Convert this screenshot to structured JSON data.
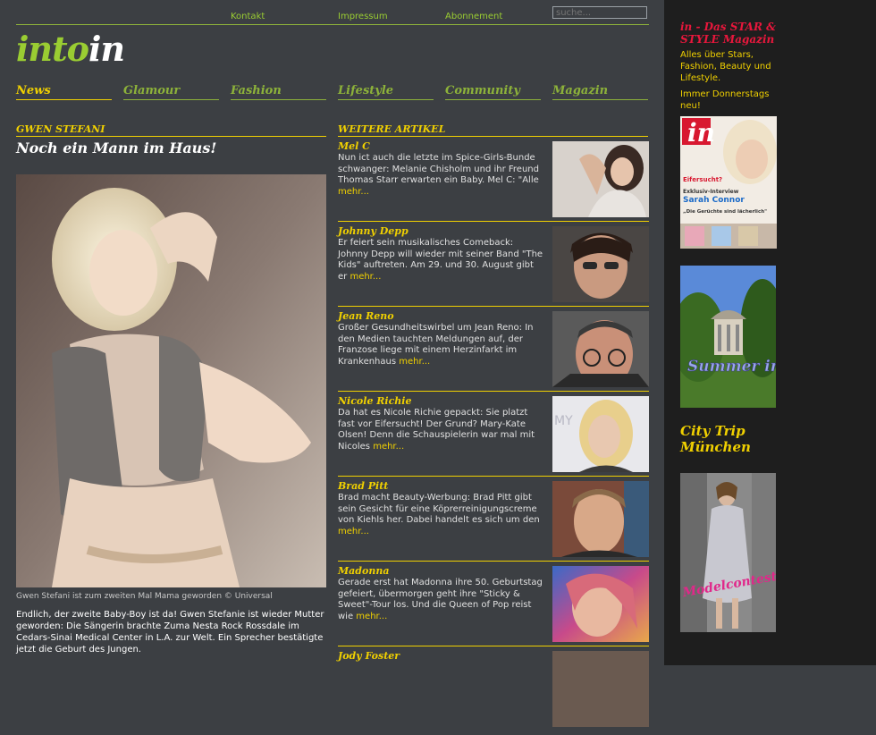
{
  "header": {
    "links": [
      "Kontakt",
      "Impressum",
      "Abonnement"
    ],
    "search_placeholder": "suche...",
    "logo_part1": "into",
    "logo_part2": "in"
  },
  "nav": [
    "News",
    "Glamour",
    "Fashion",
    "Lifestyle",
    "Community",
    "Magazin"
  ],
  "main_article": {
    "kicker": "GWEN STEFANI",
    "headline": "Noch ein Mann im Haus!",
    "caption": "Gwen Stefani ist zum zweiten Mal Mama geworden © Universal",
    "intro": "Endlich, der zweite Baby-Boy ist da! Gwen Stefanie ist wieder Mutter geworden: Die Sängerin brachte Zuma Nesta Rock Rossdale im Cedars-Sinai Medical Center in L.A. zur Welt. Ein Sprecher bestätigte jetzt die Geburt des Jungen."
  },
  "more": {
    "header": "WEITERE ARTIKEL",
    "more_label": "mehr...",
    "articles": [
      {
        "title": "Mel C",
        "text": "Nun ict auch die letzte im Spice-Girls-Bunde schwanger: Melanie Chisholm und ihr Freund Thomas Starr erwarten ein Baby. Mel C: \"Alle"
      },
      {
        "title": "Johnny Depp",
        "text": "Er feiert sein musikalisches Comeback: Johnny Depp will wieder mit seiner Band \"The Kids\" auftreten. Am 29. und 30. August gibt er"
      },
      {
        "title": "Jean Reno",
        "text": "Großer Gesundheitswirbel um Jean Reno: In den Medien tauchten Meldungen auf, der Franzose liege mit einem Herzinfarkt im Krankenhaus"
      },
      {
        "title": "Nicole Richie",
        "text": "Da hat es Nicole Richie gepackt: Sie platzt fast vor Eifersucht! Der Grund? Mary-Kate Olsen! Denn die Schauspielerin war mal mit Nicoles"
      },
      {
        "title": "Brad Pitt",
        "text": "Brad macht Beauty-Werbung: Brad Pitt gibt sein Gesicht für eine Köprerreinigungscreme von Kiehls her. Dabei handelt es sich um den"
      },
      {
        "title": "Madonna",
        "text": "Gerade erst hat Madonna ihre 50. Geburtstag gefeiert, übermorgen geht ihre \"Sticky & Sweet\"-Tour los. Und die Queen of Pop reist wie"
      },
      {
        "title": "Jody Foster",
        "text": ""
      }
    ]
  },
  "sidebar": {
    "title": "in - Das STAR & STYLE Magazin",
    "desc": "Alles über Stars, Fashion, Beauty und Lifestyle.",
    "when": "Immer Donnerstags neu!",
    "cover_logo": "in",
    "cover_lines": [
      "Eifersucht?",
      "Exklusiv-Interview",
      "Sarah Connor",
      "„Die Gerüchte sind lächerlich\""
    ],
    "summer_text": "Summer in the city",
    "city_trip": "City Trip München",
    "model_text": "Modelcontest"
  }
}
